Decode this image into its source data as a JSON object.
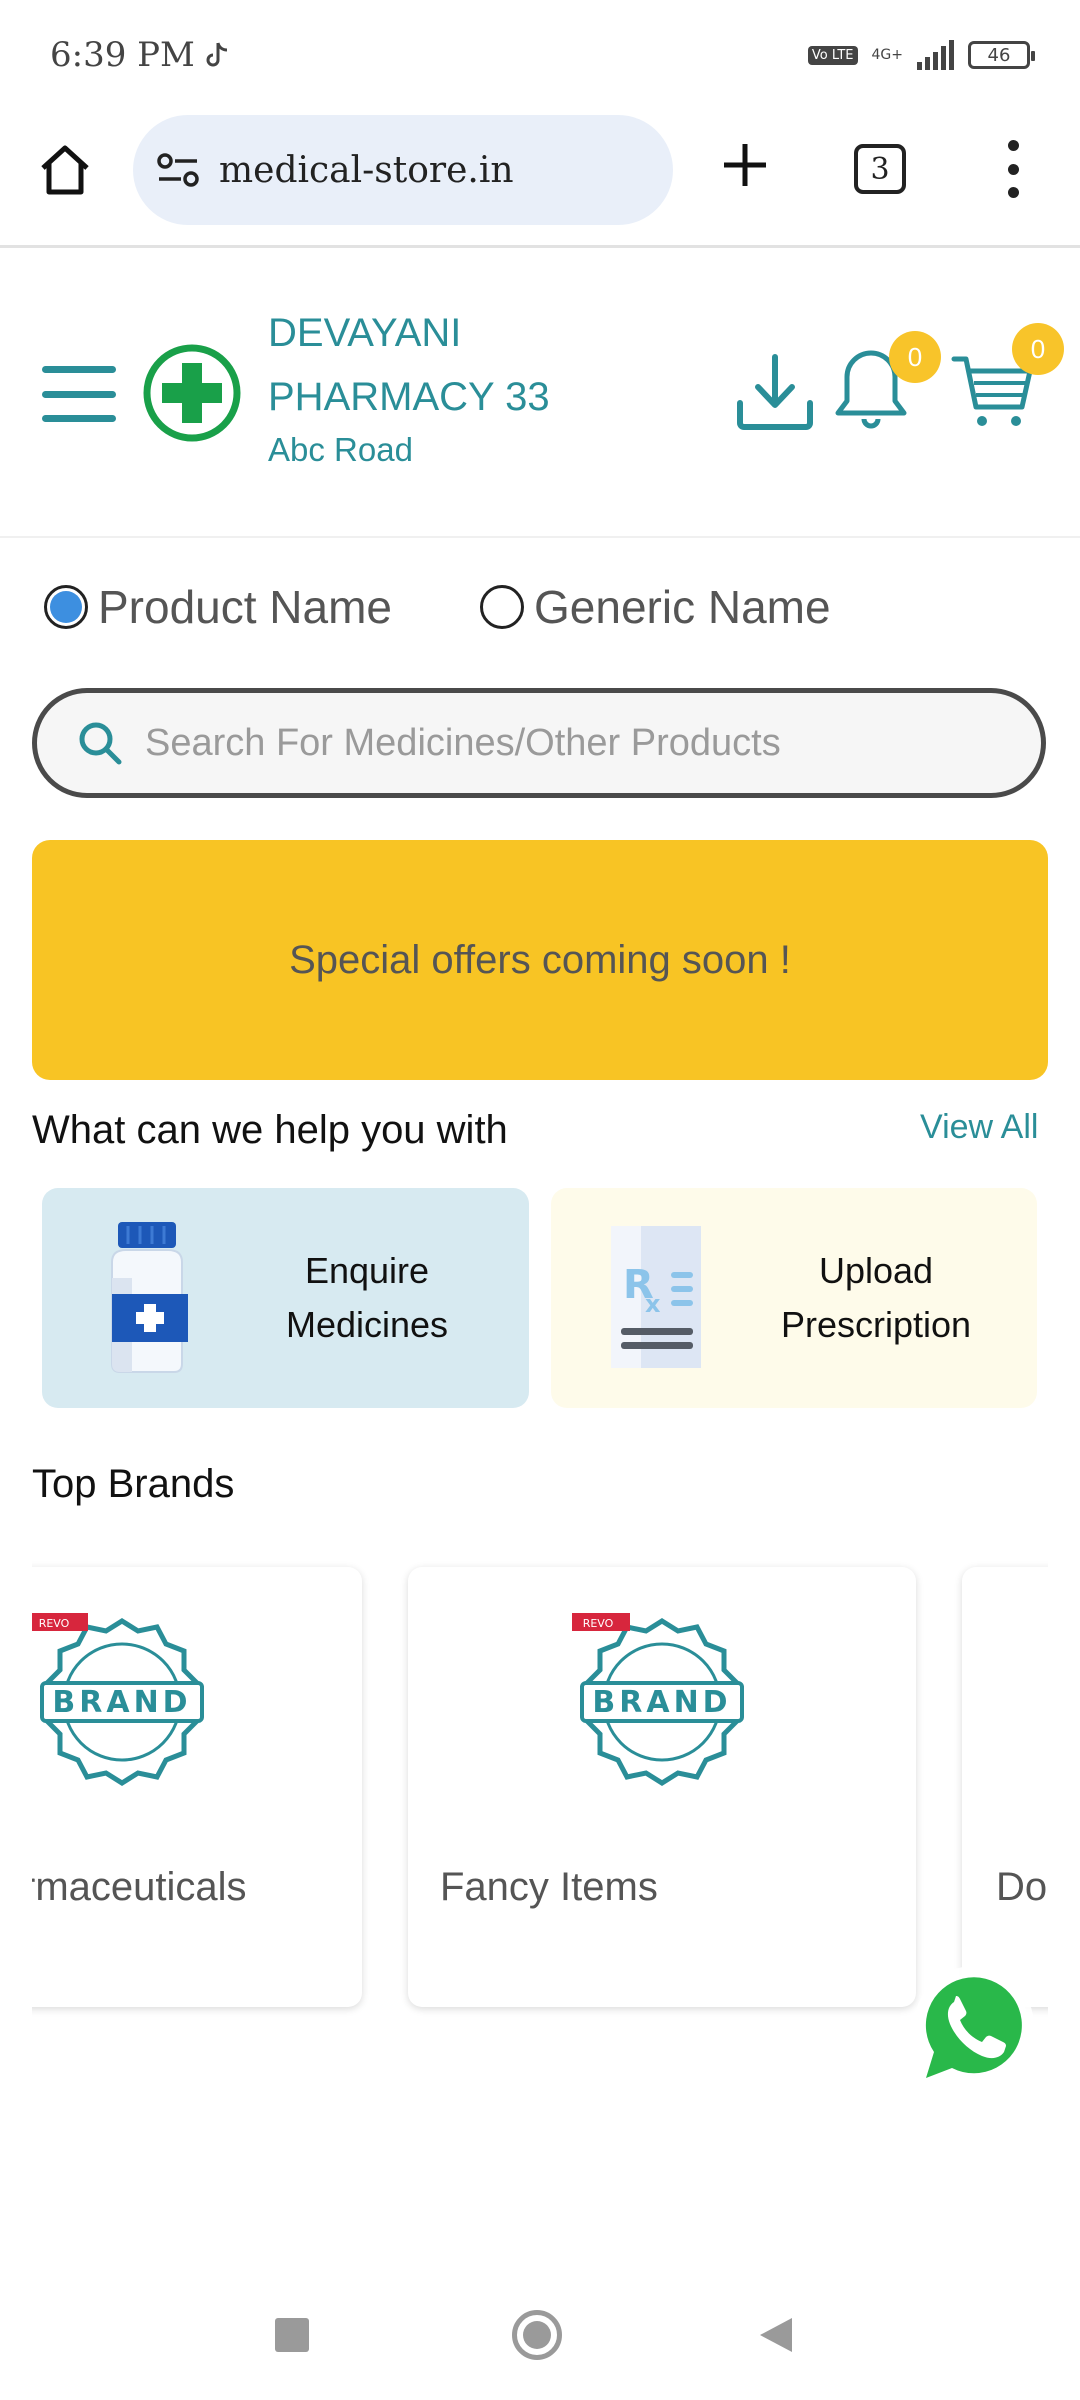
{
  "status_bar": {
    "time": "6:39 PM",
    "volte": "Vo LTE",
    "network": "4G+",
    "battery": "46"
  },
  "browser": {
    "url": "medical-store.in",
    "tab_count": "3",
    "icons": [
      "home-icon",
      "site-settings-icon",
      "plus-icon",
      "tabs-icon",
      "more-icon"
    ]
  },
  "header": {
    "store_name": "DEVAYANI PHARMACY 33",
    "store_address": "Abc Road",
    "notification_count": "0",
    "cart_count": "0",
    "accent_color": "#2a8e98",
    "logo_color": "#19a049",
    "badge_color": "#f8c42a"
  },
  "search_mode": {
    "options": [
      {
        "label": "Product Name",
        "selected": true
      },
      {
        "label": "Generic Name",
        "selected": false
      }
    ]
  },
  "search": {
    "placeholder": "Search For Medicines/Other Products",
    "value": ""
  },
  "banner": {
    "text": "Special offers coming soon !",
    "color": "#f8c424"
  },
  "help": {
    "title": "What can we help you with",
    "view_all": "View All",
    "cards": [
      {
        "label": "Enquire Medicines",
        "icon": "medicine-bottle-icon"
      },
      {
        "label": "Upload Prescription",
        "icon": "prescription-icon"
      }
    ]
  },
  "brands": {
    "title": "Top Brands",
    "items": [
      {
        "name": "rmaceuticals",
        "ribbon": "REVO",
        "badge_text": "BRAND"
      },
      {
        "name": "Fancy Items",
        "ribbon": "REVO",
        "badge_text": "BRAND"
      },
      {
        "name": "Do Ltd"
      }
    ]
  },
  "floating": {
    "icon": "whatsapp-icon",
    "color": "#29b84a"
  }
}
